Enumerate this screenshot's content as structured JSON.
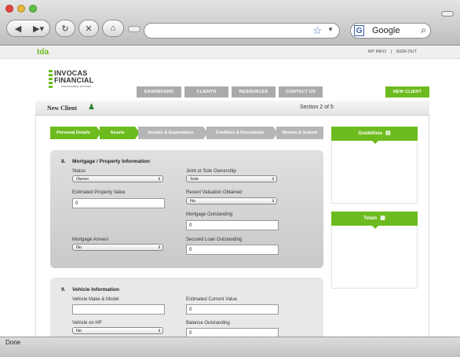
{
  "browser": {
    "search_text": "Google",
    "google_letter": "G",
    "status_text": "Done"
  },
  "site": {
    "brand": "tda",
    "top_links": [
      "MY INFO",
      "|",
      "SIGN OUT"
    ],
    "logo": {
      "line1": "INVOCAS",
      "line2": "FINANCIAL",
      "tagline": "Intermediary services"
    },
    "tabs": [
      "DASHBOARD",
      "CLIENTS",
      "RESOURCES",
      "CONTACT US"
    ],
    "new_client_button": "NEW CLIENT"
  },
  "header": {
    "title": "New Client",
    "section": "Section 2 of 5"
  },
  "steps": [
    {
      "label": "Personal Details",
      "state": "active"
    },
    {
      "label": "Assets",
      "state": "active"
    },
    {
      "label": "Income & Expenditure",
      "state": "todo"
    },
    {
      "label": "Creditors & Documents",
      "state": "todo"
    },
    {
      "label": "Review & Submit",
      "state": "todo"
    }
  ],
  "mortgage": {
    "number": "8.",
    "title": "Mortgage / Property Information",
    "status_label": "Status",
    "status_value": "Owner",
    "ownership_label": "Joint or Sole Ownership",
    "ownership_value": "Sole",
    "est_value_label": "Estimated Property Value",
    "est_value": "0",
    "recent_valuation_label": "Recent Valuation Obtained",
    "recent_valuation_value": "No",
    "mortgage_outstanding_label": "Mortgage Outstanding",
    "mortgage_outstanding_value": "0",
    "arrears_label": "Mortgage Arrears",
    "arrears_value": "No",
    "secured_loan_label": "Secured Loan Outstanding",
    "secured_loan_value": "0"
  },
  "vehicle": {
    "number": "9.",
    "title": "Vehicle Information",
    "make_label": "Vehicle Make & Model",
    "make_value": "",
    "est_value_label": "Estimated Current Value",
    "est_value": "0",
    "hp_label": "Vehicle on HP",
    "hp_value": "No",
    "balance_label": "Balance Outstanding",
    "balance_value": "0"
  },
  "sidebar": {
    "guidelines": "Guidelines",
    "totals": "Totals"
  },
  "colors": {
    "accent": "#6dbb1e",
    "tab_gray": "#aaaaaa"
  }
}
